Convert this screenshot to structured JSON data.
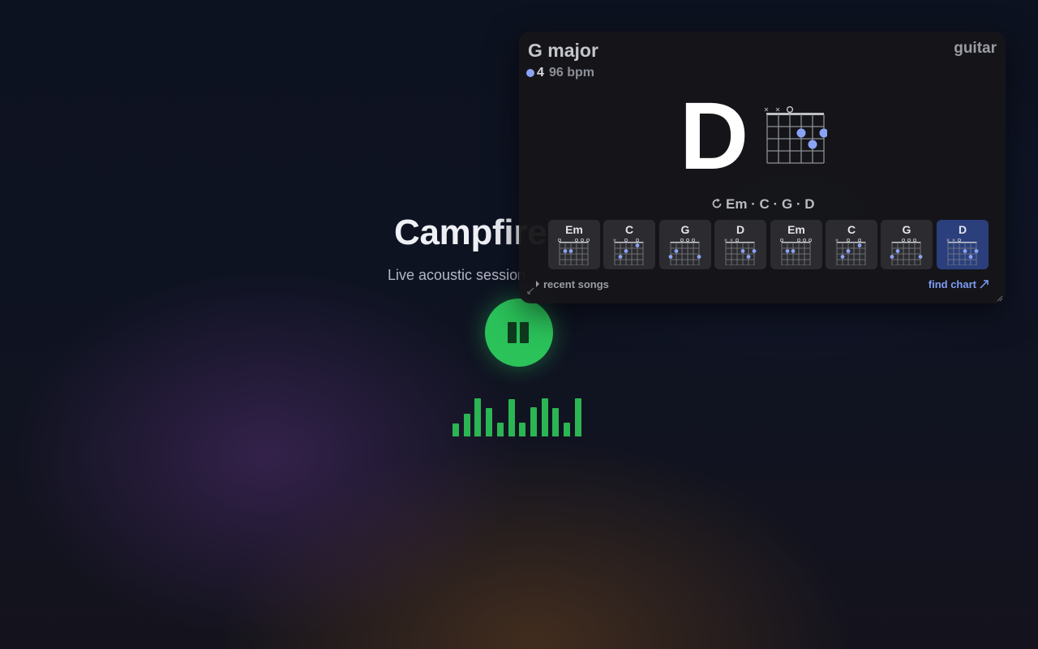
{
  "app": {
    "title": "Campfire",
    "subtitle": "Live acoustic session",
    "play_state": "playing",
    "play_color": "#2bc25a",
    "visualizer_levels": [
      0.33,
      0.58,
      0.98,
      0.73,
      0.35,
      0.96,
      0.35,
      0.75,
      0.98,
      0.73,
      0.35,
      0.98
    ]
  },
  "overlay": {
    "key": "G major",
    "beat": "4",
    "bpm": "96 bpm",
    "instrument": "guitar",
    "current_chord": "D",
    "progression_label": "Em · C · G · D",
    "accent_color": "#8aa3f5",
    "active_card_color": "#2b3f7c",
    "chords": [
      {
        "name": "Em",
        "active": false
      },
      {
        "name": "C",
        "active": false
      },
      {
        "name": "G",
        "active": false
      },
      {
        "name": "D",
        "active": false
      },
      {
        "name": "Em",
        "active": false
      },
      {
        "name": "C",
        "active": false
      },
      {
        "name": "G",
        "active": false
      },
      {
        "name": "D",
        "active": true
      }
    ],
    "recent_label": "recent songs",
    "find_label": "find chart",
    "icons": [
      "loop-icon",
      "chevron-right-icon",
      "external-arrow-icon",
      "resize-icon",
      "pause-icon"
    ]
  }
}
